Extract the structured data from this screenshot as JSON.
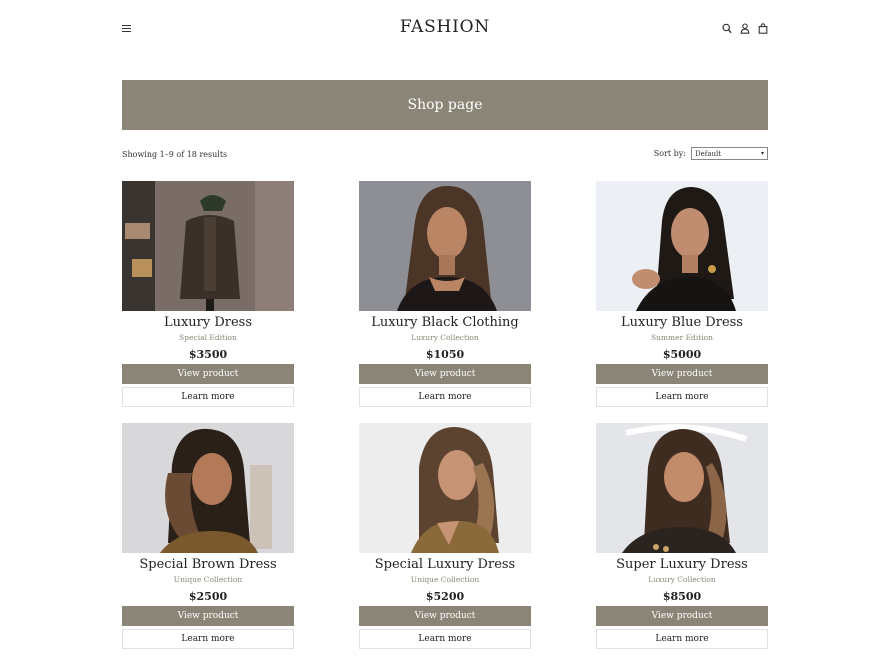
{
  "header": {
    "brand": "FASHION",
    "icons": [
      "menu-icon",
      "search-icon",
      "user-icon",
      "bag-icon"
    ]
  },
  "banner": {
    "title": "Shop page"
  },
  "toolbar": {
    "results_text": "Showing 1–9 of 18 results",
    "sort_label": "Sort by:",
    "sort_value": "Default"
  },
  "colors": {
    "accent": "#8a8576",
    "text": "#222222",
    "background": "#ffffff"
  },
  "products": [
    {
      "name": "Luxury Dress",
      "subtitle": "Special Edition",
      "price": "$3500",
      "view_label": "View product",
      "learn_label": "Learn more"
    },
    {
      "name": "Luxury Black Clothing",
      "subtitle": "Luxury Collection",
      "price": "$1050",
      "view_label": "View product",
      "learn_label": "Learn more"
    },
    {
      "name": "Luxury Blue Dress",
      "subtitle": "Summer Edition",
      "price": "$5000",
      "view_label": "View product",
      "learn_label": "Learn more"
    },
    {
      "name": "Special Brown Dress",
      "subtitle": "Unique Collection",
      "price": "$2500",
      "view_label": "View product",
      "learn_label": "Learn more"
    },
    {
      "name": "Special Luxury Dress",
      "subtitle": "Unique Collection",
      "price": "$5200",
      "view_label": "View product",
      "learn_label": "Learn more"
    },
    {
      "name": "Super Luxury Dress",
      "subtitle": "Luxury Collection",
      "price": "$8500",
      "view_label": "View product",
      "learn_label": "Learn more"
    }
  ]
}
